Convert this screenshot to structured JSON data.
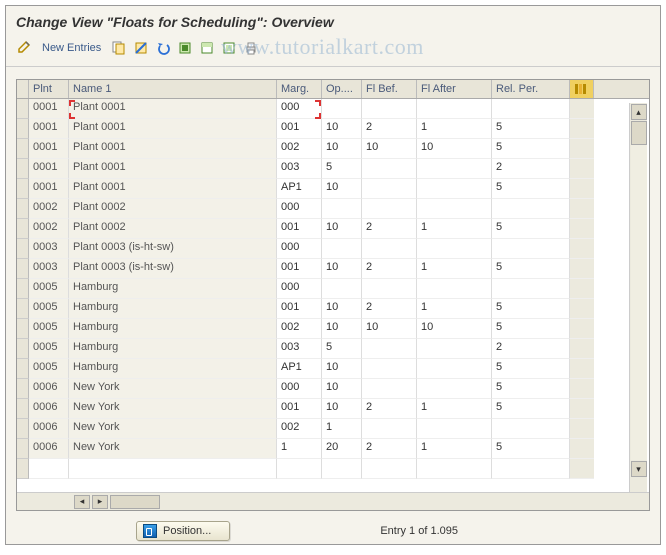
{
  "title": "Change View \"Floats for Scheduling\": Overview",
  "toolbar": {
    "new_entries": "New Entries"
  },
  "watermark": "www.tutorialkart.com",
  "grid": {
    "columns": {
      "plnt": "Plnt",
      "name1": "Name 1",
      "marg": "Marg.",
      "op": "Op....",
      "flbef": "Fl Bef.",
      "flafter": "Fl After",
      "relper": "Rel. Per."
    },
    "rows": [
      {
        "plnt": "0001",
        "name": "Plant 0001",
        "marg": "000",
        "op": "",
        "flbef": "",
        "flafter": "",
        "relper": ""
      },
      {
        "plnt": "0001",
        "name": "Plant 0001",
        "marg": "001",
        "op": "10",
        "flbef": "2",
        "flafter": "1",
        "relper": "5"
      },
      {
        "plnt": "0001",
        "name": "Plant 0001",
        "marg": "002",
        "op": "10",
        "flbef": "10",
        "flafter": "10",
        "relper": "5"
      },
      {
        "plnt": "0001",
        "name": "Plant 0001",
        "marg": "003",
        "op": "5",
        "flbef": "",
        "flafter": "",
        "relper": "2"
      },
      {
        "plnt": "0001",
        "name": "Plant 0001",
        "marg": "AP1",
        "op": "10",
        "flbef": "",
        "flafter": "",
        "relper": "5"
      },
      {
        "plnt": "0002",
        "name": "Plant 0002",
        "marg": "000",
        "op": "",
        "flbef": "",
        "flafter": "",
        "relper": ""
      },
      {
        "plnt": "0002",
        "name": "Plant 0002",
        "marg": "001",
        "op": "10",
        "flbef": "2",
        "flafter": "1",
        "relper": "5"
      },
      {
        "plnt": "0003",
        "name": "Plant 0003 (is-ht-sw)",
        "marg": "000",
        "op": "",
        "flbef": "",
        "flafter": "",
        "relper": ""
      },
      {
        "plnt": "0003",
        "name": "Plant 0003 (is-ht-sw)",
        "marg": "001",
        "op": "10",
        "flbef": "2",
        "flafter": "1",
        "relper": "5"
      },
      {
        "plnt": "0005",
        "name": "Hamburg",
        "marg": "000",
        "op": "",
        "flbef": "",
        "flafter": "",
        "relper": ""
      },
      {
        "plnt": "0005",
        "name": "Hamburg",
        "marg": "001",
        "op": "10",
        "flbef": "2",
        "flafter": "1",
        "relper": "5"
      },
      {
        "plnt": "0005",
        "name": "Hamburg",
        "marg": "002",
        "op": "10",
        "flbef": "10",
        "flafter": "10",
        "relper": "5"
      },
      {
        "plnt": "0005",
        "name": "Hamburg",
        "marg": "003",
        "op": "5",
        "flbef": "",
        "flafter": "",
        "relper": "2"
      },
      {
        "plnt": "0005",
        "name": "Hamburg",
        "marg": "AP1",
        "op": "10",
        "flbef": "",
        "flafter": "",
        "relper": "5"
      },
      {
        "plnt": "0006",
        "name": "New York",
        "marg": "000",
        "op": "10",
        "flbef": "",
        "flafter": "",
        "relper": "5"
      },
      {
        "plnt": "0006",
        "name": "New York",
        "marg": "001",
        "op": "10",
        "flbef": "2",
        "flafter": "1",
        "relper": "5"
      },
      {
        "plnt": "0006",
        "name": "New York",
        "marg": "002",
        "op": "1",
        "flbef": "",
        "flafter": "",
        "relper": ""
      },
      {
        "plnt": "0006",
        "name": "New York",
        "marg": "1",
        "op": "20",
        "flbef": "2",
        "flafter": "1",
        "relper": "5"
      }
    ]
  },
  "footer": {
    "position_label": "Position...",
    "entry_label": "Entry 1 of 1.095"
  }
}
